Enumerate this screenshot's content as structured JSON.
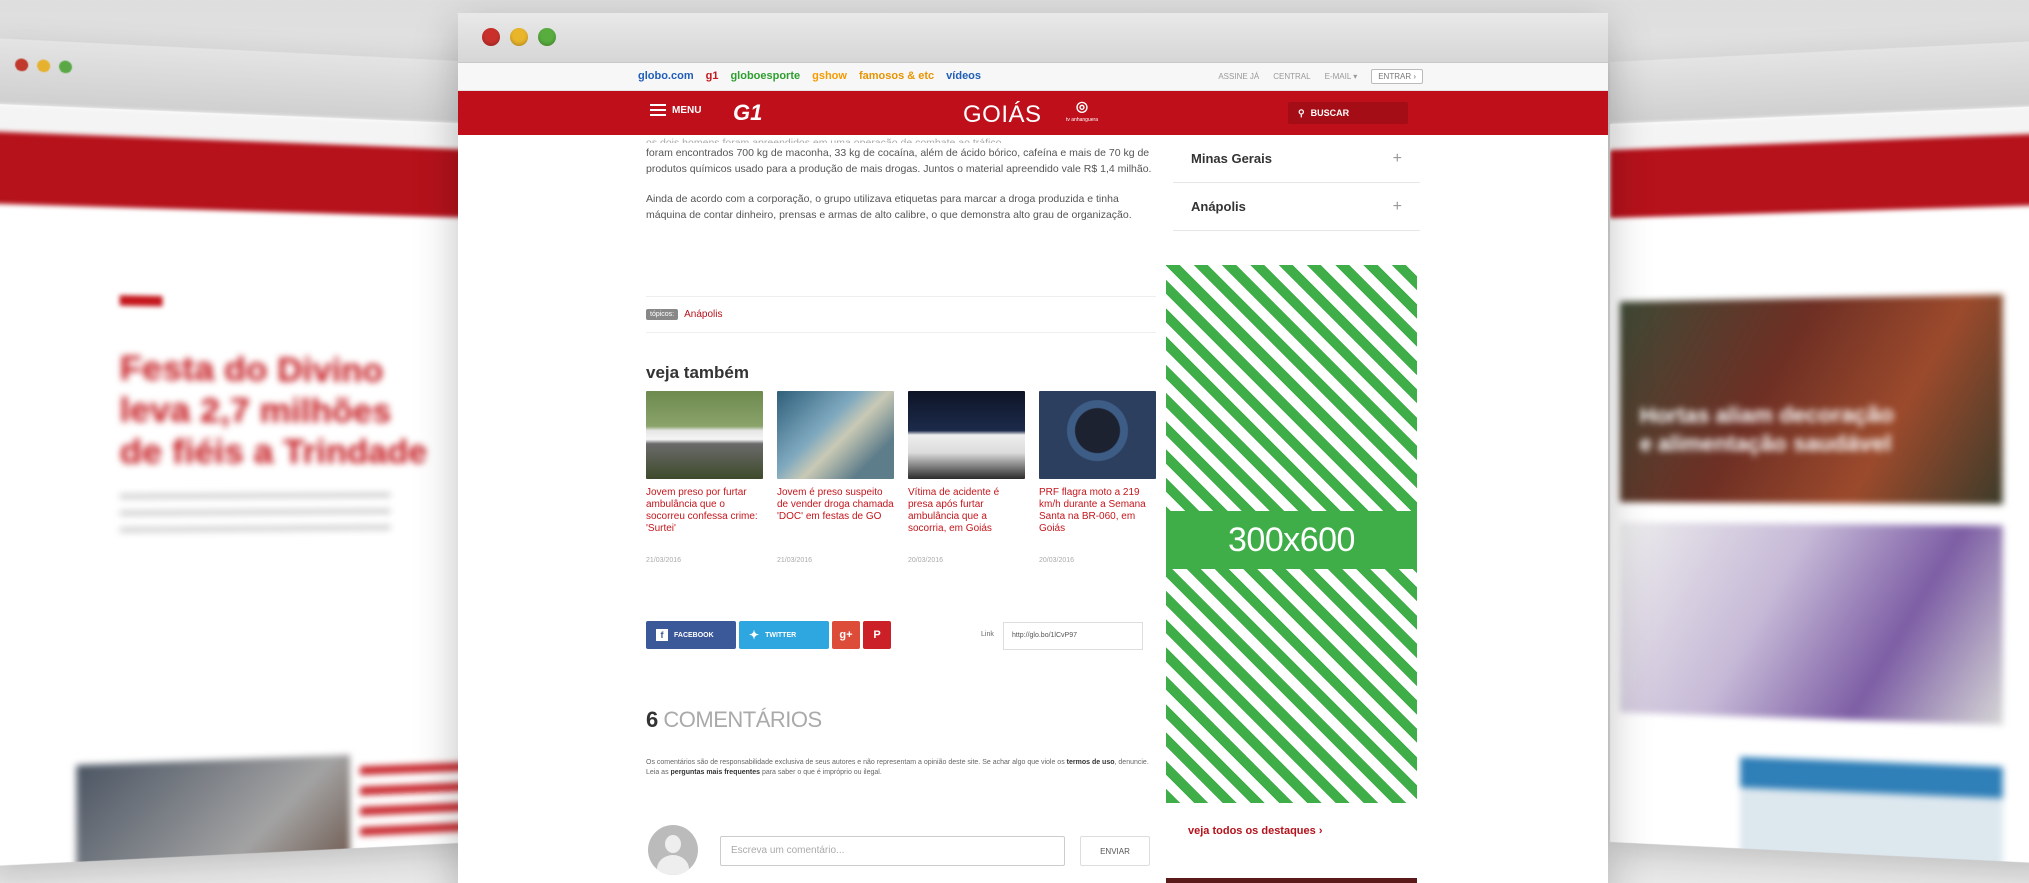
{
  "main_browser": {
    "globo_nav": {
      "links": [
        {
          "label": "globo.com",
          "color": "#1f5db8"
        },
        {
          "label": "g1",
          "color": "#c4161c"
        },
        {
          "label": "globoesporte",
          "color": "#2e9e2e"
        },
        {
          "label": "gshow",
          "color": "#f59c00"
        },
        {
          "label": "famosos & etc",
          "color": "#e89400"
        },
        {
          "label": "vídeos",
          "color": "#1f5db8"
        }
      ],
      "right": [
        "ASSINE JÁ",
        "CENTRAL",
        "E-MAIL ▾"
      ],
      "login": "ENTRAR ›"
    },
    "header": {
      "menu": "MENU",
      "logo": "G1",
      "site_title": "GOIÁS",
      "tv_logo": "tv anhanguera",
      "search": "BUSCAR",
      "accent": "#bf0f1a"
    },
    "article": {
      "p0": "os dois homens foram apreendidos em uma operação de combate ao tráfico",
      "p1": "foram encontrados 700 kg de maconha, 33 kg de cocaína, além de ácido bórico, cafeína e mais de 70 kg de produtos químicos usado para a produção de mais drogas. Juntos o material apreendido vale R$ 1,4 milhão.",
      "p2": "Ainda de acordo com a corporação, o grupo utilizava etiquetas para marcar a droga produzida e tinha máquina de contar dinheiro, prensas e armas de alto calibre, o que demonstra alto grau de organização.",
      "tag_label": "tópicos:",
      "tag": "Anápolis"
    },
    "see_also": {
      "title": "veja também",
      "cards": [
        {
          "title": "Jovem preso por furtar ambulância que o socorreu confessa crime: 'Surtei'",
          "date": "21/03/2016"
        },
        {
          "title": "Jovem é preso suspeito de vender droga chamada 'DOC' em festas de GO",
          "date": "21/03/2016"
        },
        {
          "title": "Vítima de acidente é presa após furtar ambulância que a socorria, em Goiás",
          "date": "20/03/2016"
        },
        {
          "title": "PRF flagra moto a 219 km/h durante a Semana Santa na BR-060, em Goiás",
          "date": "20/03/2016"
        }
      ]
    },
    "share": {
      "facebook": "FACEBOOK",
      "twitter": "TWITTER",
      "gplus": "g+",
      "pinterest": "P",
      "link_label": "Link",
      "link_value": "http://glo.bo/1lCvP97"
    },
    "comments": {
      "count": "6",
      "label": "COMENTÁRIOS",
      "note_a": "Os comentários são de responsabilidade exclusiva de seus autores e não representam a opinião deste site. Se achar algo que viole os ",
      "note_terms": "termos de uso",
      "note_b": ", denuncie. Leia as ",
      "note_faq": "perguntas mais frequentes",
      "note_c": " para saber o que é impróprio ou ilegal.",
      "placeholder": "Escreva um comentário...",
      "send": "ENVIAR"
    },
    "sidebar": {
      "items": [
        {
          "label": "Minas Gerais"
        },
        {
          "label": "Anápolis"
        }
      ],
      "ad_label": "300x600",
      "ad_color": "#3fae49",
      "see_all": "veja todos os destaques ›"
    }
  },
  "side_left": {
    "headline": "Festa do Divino leva 2,7 milhões de fiéis a Trindade"
  },
  "side_right": {
    "headline": "Hortas aliam decoração e alimentação saudável"
  }
}
